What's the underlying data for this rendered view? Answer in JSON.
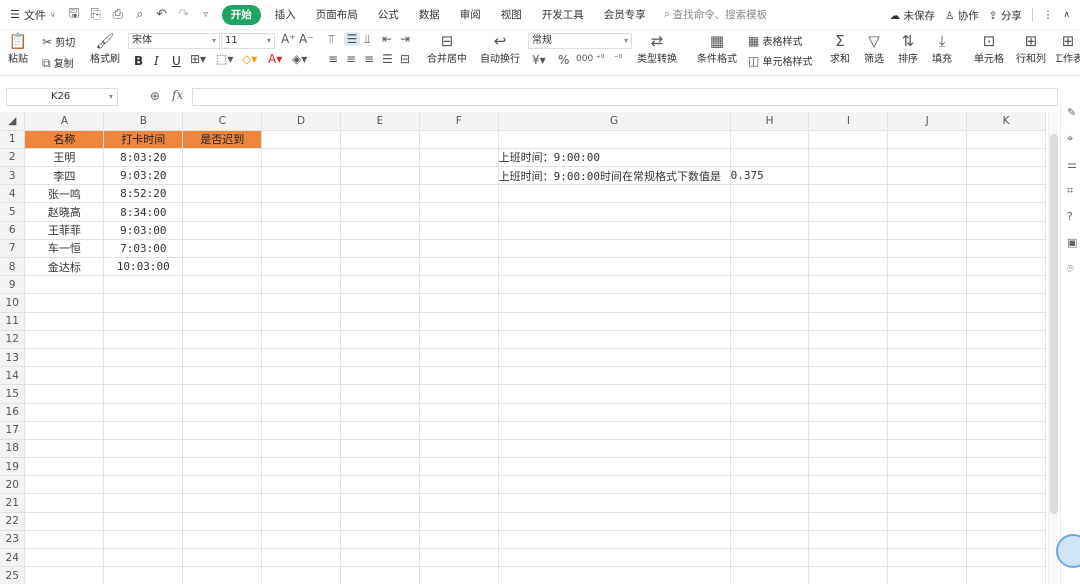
{
  "menubar": {
    "file_label": "文件",
    "tabs": [
      "开始",
      "插入",
      "页面布局",
      "公式",
      "数据",
      "审阅",
      "视图",
      "开发工具",
      "会员专享"
    ],
    "search_placeholder": "查找命令、搜索模板",
    "unsaved": "未保存",
    "collab": "协作",
    "share": "分享"
  },
  "ribbon": {
    "paste": "粘贴",
    "cut": "剪切",
    "copy": "复制",
    "format_painter": "格式刷",
    "font_name": "宋体",
    "font_size": "11",
    "merge_center": "合并居中",
    "wrap_text": "自动换行",
    "number_format": "常规",
    "type_convert": "类型转换",
    "cond_format": "条件格式",
    "table_style": "表格样式",
    "cell_style": "单元格样式",
    "sum": "求和",
    "filter": "筛选",
    "sort": "排序",
    "fill": "填充",
    "cell": "单元格",
    "rows_cols": "行和列",
    "worksheet": "工作表"
  },
  "formula_bar": {
    "cell_ref": "K26",
    "fx": "fx",
    "formula": ""
  },
  "sheet": {
    "columns": [
      "A",
      "B",
      "C",
      "D",
      "E",
      "F",
      "G",
      "H",
      "I",
      "J",
      "K"
    ],
    "rows": [
      "1",
      "2",
      "3",
      "4",
      "5",
      "6",
      "7",
      "8",
      "9",
      "10",
      "11",
      "12",
      "13",
      "14",
      "15",
      "16",
      "17",
      "18",
      "19",
      "20",
      "21",
      "22",
      "23",
      "24",
      "25"
    ],
    "headers": {
      "a1": "名称",
      "b1": "打卡时间",
      "c1": "是否迟到"
    },
    "data": [
      {
        "name": "王明",
        "time": "8:03:20"
      },
      {
        "name": "李四",
        "time": "9:03:20"
      },
      {
        "name": "张一鸣",
        "time": "8:52:20"
      },
      {
        "name": "赵晓高",
        "time": "8:34:00"
      },
      {
        "name": "王菲菲",
        "time": "9:03:00"
      },
      {
        "name": "车一恒",
        "time": "7:03:00"
      },
      {
        "name": "金达标",
        "time": "10:03:00"
      }
    ],
    "g2": "上班时间：9:00:00",
    "g3": "上班时间：9:00:00时间在常规格式下数值是",
    "h3": "0.375"
  }
}
